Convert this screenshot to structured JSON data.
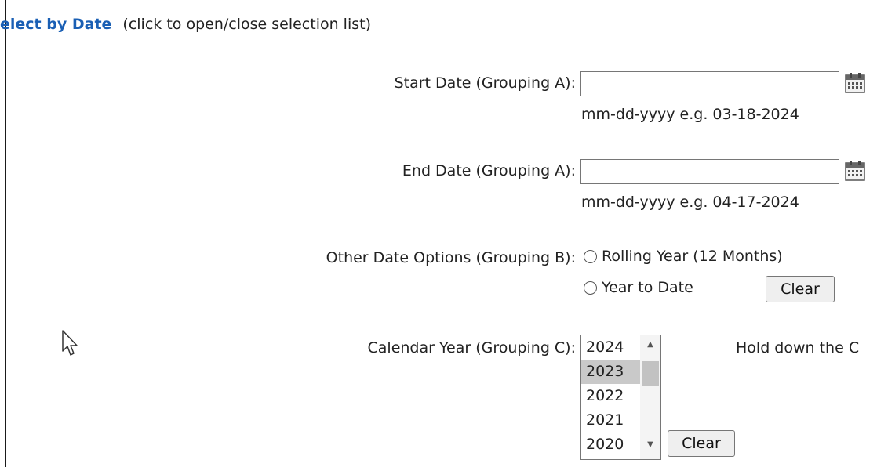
{
  "header": {
    "title": "elect by Date",
    "hint": "(click to open/close selection list)"
  },
  "start_date": {
    "label": "Start Date (Grouping A):",
    "value": "",
    "format_hint": "mm-dd-yyyy e.g. 03-18-2024",
    "icon": "calendar-icon"
  },
  "end_date": {
    "label": "End Date (Grouping A):",
    "value": "",
    "format_hint": "mm-dd-yyyy e.g. 04-17-2024",
    "icon": "calendar-icon"
  },
  "other_options": {
    "label": "Other Date Options (Grouping B):",
    "options": [
      "Rolling Year (12 Months)",
      "Year to Date"
    ],
    "clear_label": "Clear"
  },
  "calendar_year": {
    "label": "Calendar Year (Grouping C):",
    "years": [
      "2024",
      "2023",
      "2022",
      "2021",
      "2020"
    ],
    "selected": "2023",
    "clear_label": "Clear",
    "hint": "Hold down the C"
  },
  "colors": {
    "header_link": "#1a5fb4",
    "selected_option": "#c9c9c9"
  }
}
